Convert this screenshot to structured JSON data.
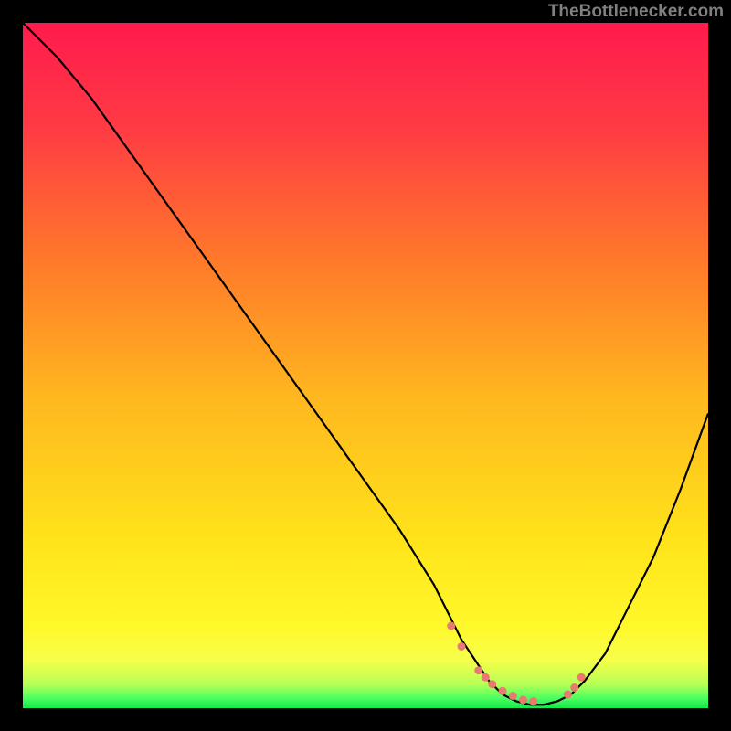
{
  "watermark": "TheBottlenecker.com",
  "chart_data": {
    "type": "line",
    "title": "",
    "xlabel": "",
    "ylabel": "",
    "xlim": [
      0,
      100
    ],
    "ylim": [
      0,
      100
    ],
    "curve": {
      "x": [
        0,
        5,
        10,
        15,
        20,
        25,
        30,
        35,
        40,
        45,
        50,
        55,
        60,
        62,
        64,
        66,
        68,
        70,
        72,
        74,
        76,
        78,
        80,
        82,
        85,
        88,
        92,
        96,
        100
      ],
      "y": [
        100,
        95,
        89,
        82,
        75,
        68,
        61,
        54,
        47,
        40,
        33,
        26,
        18,
        14,
        10,
        7,
        4,
        2,
        1,
        0.5,
        0.5,
        1,
        2,
        4,
        8,
        14,
        22,
        32,
        43
      ]
    },
    "markers": {
      "x": [
        62.5,
        64,
        66.5,
        67.5,
        68.5,
        70,
        71.5,
        73,
        74.5,
        79.5,
        80.5,
        81.5
      ],
      "y": [
        12,
        9,
        5.5,
        4.5,
        3.5,
        2.5,
        1.8,
        1.2,
        1.0,
        2.0,
        3.0,
        4.5
      ]
    },
    "gradient_stops": [
      {
        "offset": 0,
        "color": "#ff1a4d"
      },
      {
        "offset": 0.15,
        "color": "#ff3a44"
      },
      {
        "offset": 0.35,
        "color": "#ff7a2a"
      },
      {
        "offset": 0.55,
        "color": "#ffb81f"
      },
      {
        "offset": 0.75,
        "color": "#ffe21a"
      },
      {
        "offset": 0.88,
        "color": "#fff82a"
      },
      {
        "offset": 0.93,
        "color": "#f6ff4a"
      },
      {
        "offset": 0.965,
        "color": "#b8ff55"
      },
      {
        "offset": 0.985,
        "color": "#4dff60"
      },
      {
        "offset": 1.0,
        "color": "#15e84a"
      }
    ],
    "marker_color": "#e87a70",
    "curve_color": "#000000"
  }
}
